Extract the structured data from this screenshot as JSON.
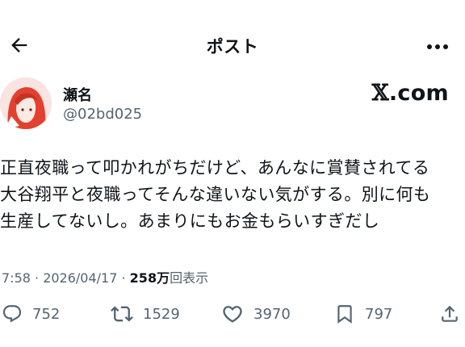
{
  "header": {
    "title": "ポスト"
  },
  "author": {
    "name": "瀬名",
    "handle": "@02bd025"
  },
  "source": {
    "site": "X.com",
    "site_rest": ".com"
  },
  "post": {
    "lines": [
      "正直夜職って叩かれがちだけど、あんなに賞賛されてる",
      "大谷翔平と夜職ってそんな違いない気がする。別に何も",
      "生産してないし。あまりにもお金もらいすぎだし"
    ]
  },
  "meta": {
    "time_date": "7:58 · 2026/04/17 · ",
    "views": "258万",
    "views_label": "回表示"
  },
  "stats": {
    "replies": "752",
    "reposts": "1529",
    "likes": "3970",
    "bookmarks": "797"
  },
  "colors": {
    "text": "#0f1419",
    "muted": "#536471",
    "avatar_accent": "#e8463a"
  },
  "icons": {
    "back": "arrow-left-icon",
    "more": "more-horizontal-icon",
    "reply": "reply-icon",
    "repost": "repost-icon",
    "like": "heart-icon",
    "bookmark": "bookmark-icon",
    "share": "share-icon"
  }
}
